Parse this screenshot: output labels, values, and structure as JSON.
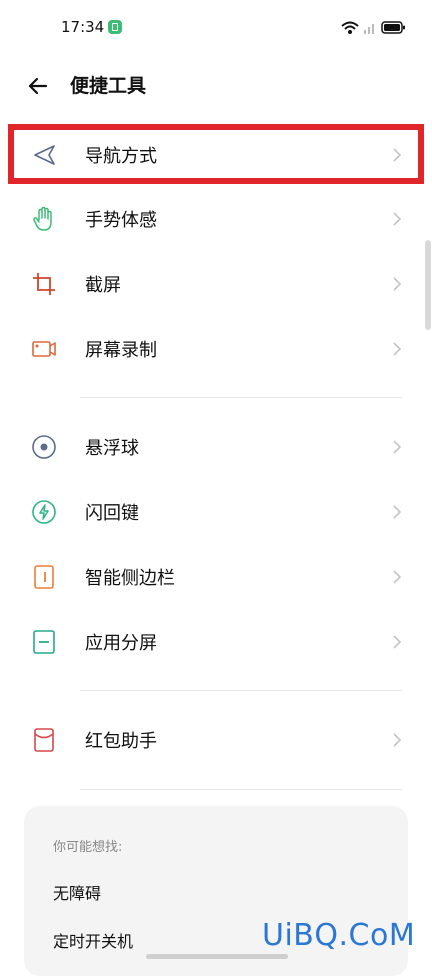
{
  "status": {
    "time": "17:34"
  },
  "header": {
    "title": "便捷工具"
  },
  "items": [
    {
      "label": "导航方式",
      "icon": "navigation-arrow-icon",
      "color": "#5a6b8c"
    },
    {
      "label": "手势体感",
      "icon": "hand-gesture-icon",
      "color": "#3dbb77"
    },
    {
      "label": "截屏",
      "icon": "crop-screenshot-icon",
      "color": "#d0452b"
    },
    {
      "label": "屏幕录制",
      "icon": "screen-record-icon",
      "color": "#e0663a"
    },
    {
      "label": "悬浮球",
      "icon": "floating-ball-icon",
      "color": "#5a6b8c"
    },
    {
      "label": "闪回键",
      "icon": "flashback-bolt-icon",
      "color": "#2db48a"
    },
    {
      "label": "智能侧边栏",
      "icon": "smart-sidebar-icon",
      "color": "#e8813a"
    },
    {
      "label": "应用分屏",
      "icon": "split-screen-icon",
      "color": "#27a98b"
    },
    {
      "label": "红包助手",
      "icon": "red-envelope-icon",
      "color": "#d9484a"
    }
  ],
  "suggest": {
    "title": "你可能想找:",
    "items": [
      "无障碍",
      "定时开关机"
    ]
  },
  "watermark": "UiBQ.CoM",
  "colors": {
    "highlight": "#e0262b",
    "card_bg": "#f4f4f4"
  }
}
